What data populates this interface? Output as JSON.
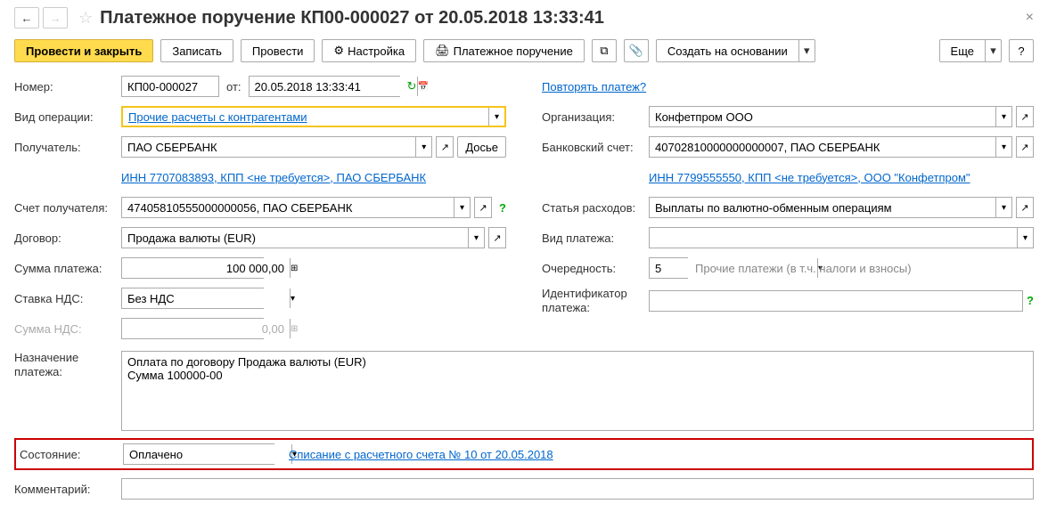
{
  "header": {
    "title": "Платежное поручение КП00-000027 от 20.05.2018 13:33:41"
  },
  "toolbar": {
    "post_close": "Провести и закрыть",
    "save": "Записать",
    "post": "Провести",
    "settings": "Настройка",
    "print": "Платежное поручение",
    "create_based": "Создать на основании",
    "more": "Еще"
  },
  "left": {
    "number_label": "Номер:",
    "number": "КП00-000027",
    "from_label": "от:",
    "date": "20.05.2018 13:33:41",
    "op_type_label": "Вид операции:",
    "op_type": "Прочие расчеты с контрагентами",
    "recipient_label": "Получатель:",
    "recipient": "ПАО СБЕРБАНК",
    "dossier": "Досье",
    "inn_link": "ИНН 7707083893, КПП <не требуется>, ПАО СБЕРБАНК",
    "recipient_account_label": "Счет получателя:",
    "recipient_account": "47405810555000000056, ПАО СБЕРБАНК",
    "contract_label": "Договор:",
    "contract": "Продажа валюты (EUR)",
    "amount_label": "Сумма платежа:",
    "amount": "100 000,00",
    "vat_rate_label": "Ставка НДС:",
    "vat_rate": "Без НДС",
    "vat_sum_label": "Сумма НДС:",
    "vat_sum": "0,00",
    "purpose_label": "Назначение платежа:",
    "purpose": "Оплата по договору Продажа валюты (EUR)\nСумма 100000-00",
    "status_label": "Состояние:",
    "status": "Оплачено",
    "status_link": "Списание с расчетного счета № 10 от 20.05.2018",
    "comment_label": "Комментарий:"
  },
  "right": {
    "repeat_link": "Повторять платеж?",
    "org_label": "Организация:",
    "org": "Конфетпром ООО",
    "bank_account_label": "Банковский счет:",
    "bank_account": "40702810000000000007, ПАО СБЕРБАНК",
    "inn_link": "ИНН 7799555550, КПП <не требуется>, ООО \"Конфетпром\"",
    "expense_label": "Статья расходов:",
    "expense": "Выплаты по валютно-обменным операциям",
    "payment_type_label": "Вид платежа:",
    "payment_type": "",
    "priority_label": "Очередность:",
    "priority": "5",
    "priority_hint": "Прочие платежи (в т.ч. налоги и взносы)",
    "identifier_label": "Идентификатор платежа:",
    "identifier": ""
  }
}
